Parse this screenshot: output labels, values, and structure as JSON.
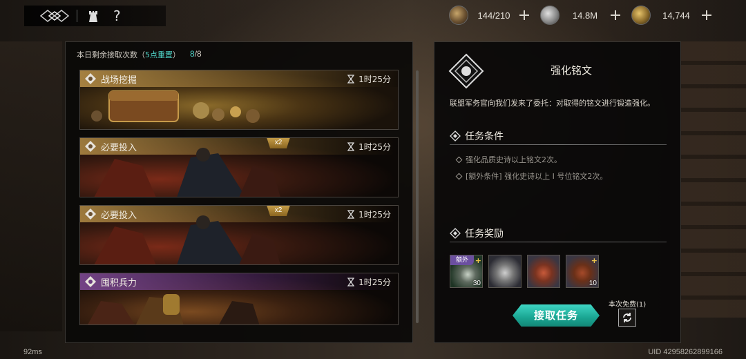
{
  "topbar": {
    "logo_icon": "guild-emblem-icon",
    "tower_icon": "tower-icon",
    "help_label": "?"
  },
  "resources": [
    {
      "icon": "axe-icon",
      "value": "144/210"
    },
    {
      "icon": "silver-coin-icon",
      "value": "14.8M"
    },
    {
      "icon": "gold-shield-icon",
      "value": "14,744"
    }
  ],
  "daily": {
    "label": "本日剩余接取次数（",
    "reset": "5点重置",
    "close": "）",
    "remaining": "8",
    "sep": "/",
    "total": "8"
  },
  "missions": [
    {
      "title": "战场挖掘",
      "time": "1时25分",
      "badge": "",
      "theme": "gold"
    },
    {
      "title": "必要投入",
      "time": "1时25分",
      "badge": "x2",
      "theme": "red"
    },
    {
      "title": "必要投入",
      "time": "1时25分",
      "badge": "x2",
      "theme": "red"
    },
    {
      "title": "囤积兵力",
      "time": "1时25分",
      "badge": "",
      "theme": "purple"
    }
  ],
  "detail": {
    "title": "强化铭文",
    "description": "联盟军务官向我们发来了委托：对取得的铭文进行锻造强化。",
    "conditions_heading": "任务条件",
    "conditions": [
      "强化品质史诗以上铭文2次。",
      "[额外条件] 强化史诗以上 I 号位铭文2次。"
    ],
    "rewards_heading": "任务奖励",
    "rewards": [
      {
        "tag": "额外",
        "qty": "30",
        "plus": "+"
      },
      {
        "tag": "",
        "qty": "",
        "plus": ""
      },
      {
        "tag": "",
        "qty": "",
        "plus": ""
      },
      {
        "tag": "",
        "qty": "10",
        "plus": "+"
      }
    ],
    "accept_label": "接取任务",
    "free_label": "本次免费(1)"
  },
  "footer": {
    "fps": "92ms",
    "uid": "UID 42958262899166"
  },
  "colors": {
    "accent_teal": "#4fd1c5",
    "button_teal": "#1aa592",
    "badge_gold": "#c9a04a",
    "extra_purple": "#6b4fa0"
  }
}
